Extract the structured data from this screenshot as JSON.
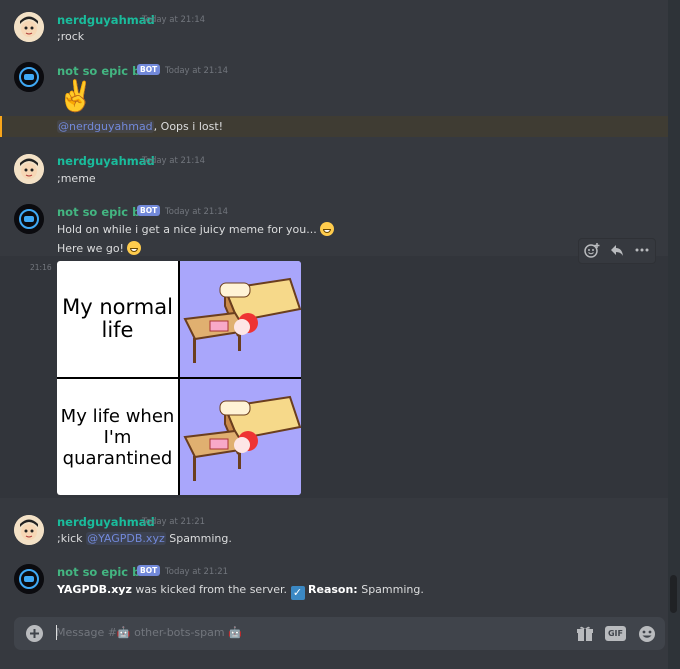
{
  "channel": {
    "placeholder": "Message #🤖 other-bots-spam 🤖"
  },
  "messages": [
    {
      "author": "nerdguyahmad",
      "timestamp": "Today at 21:14",
      "text": ";rock"
    },
    {
      "author": "not so epic bot",
      "tag": "BOT",
      "timestamp": "Today at 21:14",
      "emoji": "✌️",
      "reply_mention": "@nerdguyahmad",
      "reply_text": ", Oops i lost!"
    },
    {
      "author": "nerdguyahmad",
      "timestamp": "Today at 21:14",
      "text": ";meme"
    },
    {
      "author": "not so epic bot",
      "tag": "BOT",
      "timestamp": "Today at 21:14",
      "line1": "Hold on while i get a nice juicy meme for you...",
      "line2": "Here we go!",
      "hover_time": "21:16",
      "meme": {
        "top_label": "My normal life",
        "bottom_label": "My life when I'm quarantined"
      }
    },
    {
      "author": "nerdguyahmad",
      "timestamp": "Today at 21:21",
      "cmd": ";kick",
      "mention": "@YAGPDB.xyz",
      "rest": " Spamming."
    },
    {
      "author": "not so epic bot",
      "tag": "BOT",
      "timestamp": "Today at 21:21",
      "kicked_user": "YAGPDB.xyz",
      "kicked_text": " was kicked from the server.",
      "reason_label": "Reason:",
      "reason_text": " Spamming."
    }
  ],
  "toolbar": {
    "add_reaction": "add-reaction-icon",
    "reply": "reply-icon",
    "more": "more-icon"
  },
  "composer": {
    "gift_label": "gift-icon",
    "gif_label": "GIF",
    "emoji_label": "emoji-icon"
  }
}
